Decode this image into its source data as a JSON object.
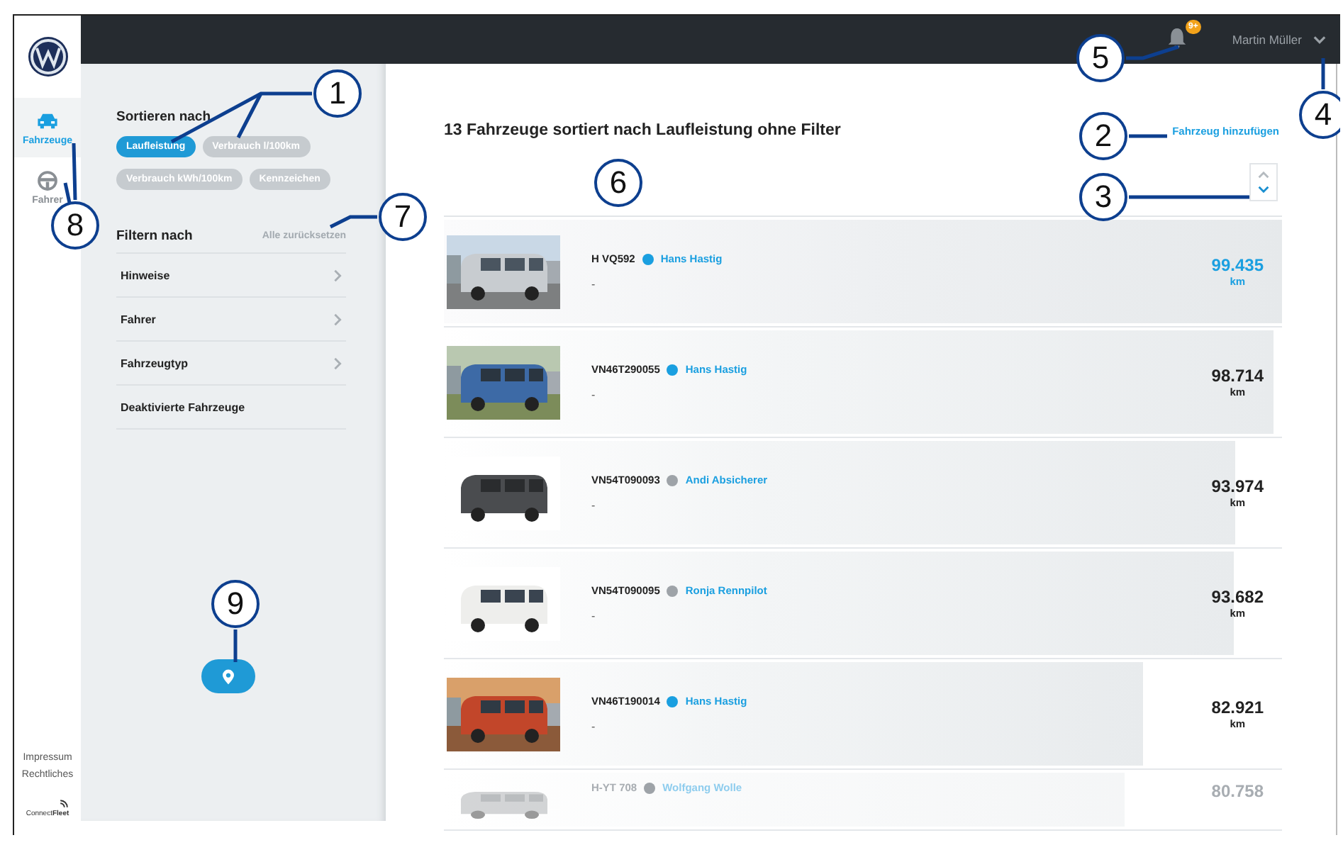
{
  "top_bar": {
    "notification_badge": "9+",
    "user_name": "Martin Müller"
  },
  "nav": [
    {
      "label": "Fahrzeuge",
      "kind": "car",
      "selected": true
    },
    {
      "label": "Fahrer",
      "kind": "steering-wheel",
      "selected": false
    }
  ],
  "footer_links": [
    "Impressum",
    "Rechtliches"
  ],
  "brand": "Connect**Fleet**",
  "sort": {
    "title": "Sortieren nach",
    "options": [
      {
        "label": "Laufleistung",
        "selected": true
      },
      {
        "label": "Verbrauch l/100km",
        "selected": false
      },
      {
        "label": "Verbrauch kWh/100km",
        "selected": false
      },
      {
        "label": "Kennzeichen",
        "selected": false
      }
    ]
  },
  "filter": {
    "title": "Filtern nach",
    "reset": "Alle zurücksetzen",
    "items": [
      {
        "label": "Hinweise",
        "has_arrow": true
      },
      {
        "label": "Fahrer",
        "has_arrow": true
      },
      {
        "label": "Fahrzeugtyp",
        "has_arrow": true
      },
      {
        "label": "Deaktivierte Fahrzeuge",
        "has_arrow": false
      }
    ]
  },
  "main": {
    "title": "13 Fahrzeuge sortiert nach Laufleistung ohne Filter",
    "add_link": "Fahrzeug hinzufügen",
    "descending": true
  },
  "vehicles": [
    {
      "plate": "H VQ592",
      "color": "#1a9fe0",
      "driver": "Hans Hastig",
      "note": "-",
      "mileage": "99.435",
      "unit": "km",
      "level": 1.0,
      "selected": true,
      "faded": false
    },
    {
      "plate": "VN46T290055",
      "color": "#1a9fe0",
      "driver": "Hans Hastig",
      "note": "-",
      "mileage": "98.714",
      "unit": "km",
      "level": 0.99,
      "selected": false,
      "faded": false
    },
    {
      "plate": "VN54T090093",
      "color": "#9ea3a8",
      "driver": "Andi Absicherer",
      "note": "-",
      "mileage": "93.974",
      "unit": "km",
      "level": 0.945,
      "selected": false,
      "faded": false
    },
    {
      "plate": "VN54T090095",
      "color": "#9ea3a8",
      "driver": "Ronja Rennpilot",
      "note": "-",
      "mileage": "93.682",
      "unit": "km",
      "level": 0.942,
      "selected": false,
      "faded": false
    },
    {
      "plate": "VN46T190014",
      "color": "#1a9fe0",
      "driver": "Hans Hastig",
      "note": "-",
      "mileage": "82.921",
      "unit": "km",
      "level": 0.834,
      "selected": false,
      "faded": false
    },
    {
      "plate": "H-YT 708",
      "color": "#9ea3a8",
      "driver": "Wolfgang Wolle",
      "mileage": "80.758",
      "level": 0.812,
      "selected": false,
      "faded": true
    }
  ],
  "callouts": [
    {
      "label": "1"
    },
    {
      "label": "2"
    },
    {
      "label": "3"
    },
    {
      "label": "4"
    },
    {
      "label": "5"
    },
    {
      "label": "6"
    },
    {
      "label": "7"
    },
    {
      "label": "8"
    },
    {
      "label": "9"
    }
  ]
}
